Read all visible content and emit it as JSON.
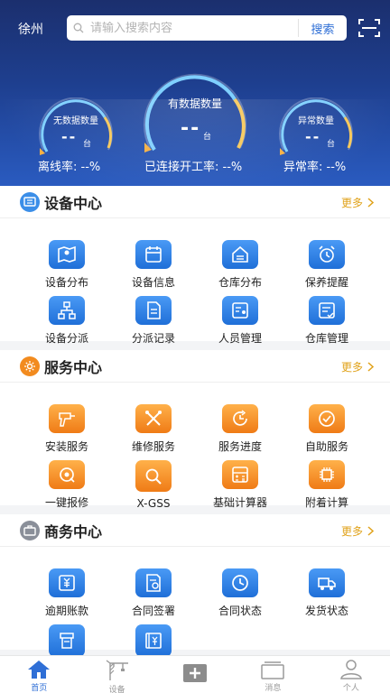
{
  "header": {
    "city": "徐州",
    "search_placeholder": "请输入搜索内容",
    "search_button": "搜索"
  },
  "gauges": {
    "left": {
      "title": "无数据数量",
      "value": "--",
      "unit": "台"
    },
    "center": {
      "title": "有数据数量",
      "value": "--",
      "unit": "台"
    },
    "right": {
      "title": "异常数量",
      "value": "--",
      "unit": "台"
    }
  },
  "stats": {
    "offline": "离线率: --%",
    "online": "已连接开工率: --%",
    "abnormal": "异常率: --%"
  },
  "sections": {
    "device": {
      "title": "设备中心",
      "more": "更多",
      "items": [
        "设备分布",
        "设备信息",
        "仓库分布",
        "保养提醒",
        "设备分派",
        "分派记录",
        "人员管理",
        "仓库管理"
      ]
    },
    "service": {
      "title": "服务中心",
      "more": "更多",
      "items": [
        "安装服务",
        "维修服务",
        "服务进度",
        "自助服务",
        "一键报修",
        "X-GSS",
        "基础计算器",
        "附着计算"
      ]
    },
    "business": {
      "title": "商务中心",
      "more": "更多",
      "items": [
        "逾期账款",
        "合同签署",
        "合同状态",
        "发货状态"
      ]
    }
  },
  "tabbar": {
    "items": [
      "首页",
      "设备",
      "",
      "消息",
      "个人"
    ]
  },
  "colors": {
    "accent": "#2f6fd6",
    "service_orange": "#f28b1f",
    "more_gold": "#e0a21a"
  }
}
